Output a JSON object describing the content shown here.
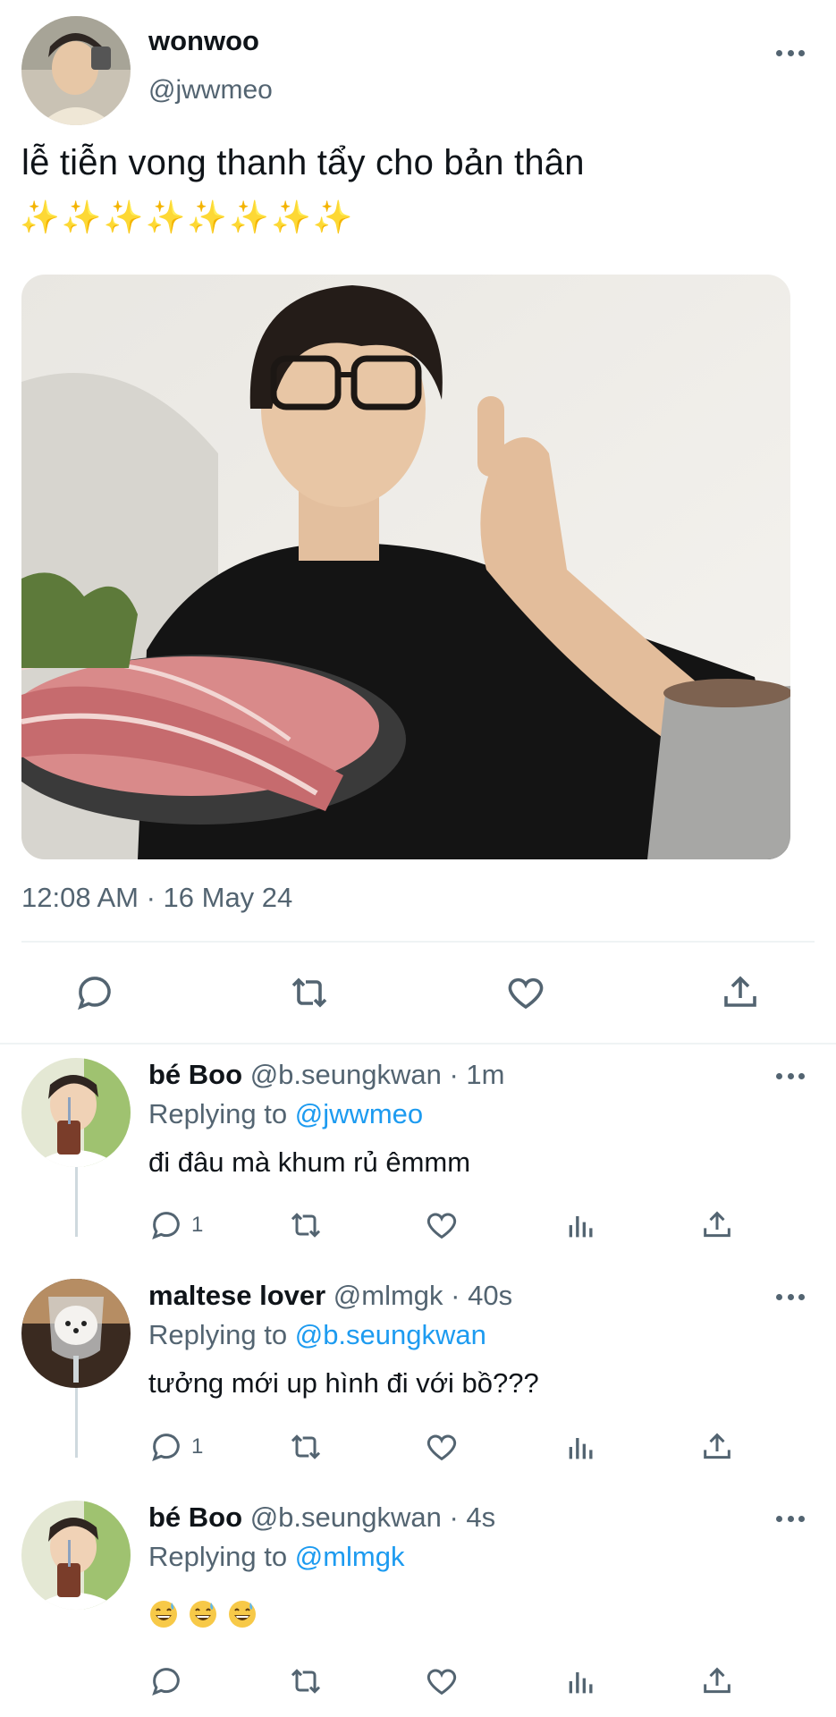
{
  "tweet": {
    "display_name": "wonwoo",
    "handle": "@jwwmeo",
    "text": "lễ tiễn vong thanh tẩy cho bản thân",
    "sparkles": "✨✨✨✨✨✨✨✨",
    "timestamp": "12:08 AM · 16 May 24",
    "avatar_icon": "user-avatar-photo",
    "photo_icon": "tweet-photo"
  },
  "replies": [
    {
      "name": "bé Boo",
      "meta": "@b.seungkwan · 1m",
      "replying_prefix": "Replying to ",
      "replying_to": "@jwwmeo",
      "text": "đi đâu mà khum rủ êmmm",
      "reply_count": "1"
    },
    {
      "name": "maltese lover",
      "meta": "@mlmgk · 40s",
      "replying_prefix": "Replying to ",
      "replying_to": "@b.seungkwan",
      "text": "tưởng mới up hình đi với bồ???",
      "reply_count": "1"
    },
    {
      "name": "bé Boo",
      "meta": "@b.seungkwan · 4s",
      "replying_prefix": "Replying to ",
      "replying_to": "@mlmgk",
      "text": "",
      "emojis": [
        "grinning-sweat-emoji",
        "grinning-sweat-emoji",
        "grinning-sweat-emoji"
      ],
      "reply_count": ""
    }
  ],
  "colors": {
    "link": "#1d9bf0",
    "secondary_text": "#536471",
    "divider": "#eff3f4"
  }
}
